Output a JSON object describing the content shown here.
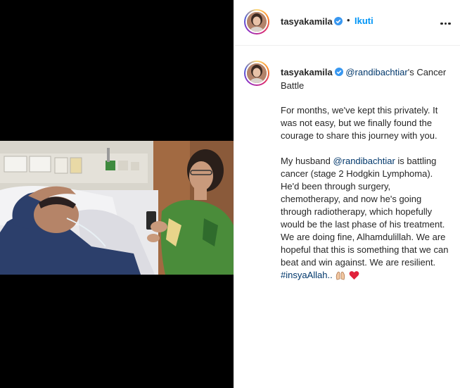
{
  "post": {
    "username": "tasyakamila",
    "follow_label": "Ikuti",
    "dot": "•"
  },
  "caption": {
    "username": "tasyakamila",
    "mention1": "@randibachtiar",
    "head_suffix": "'s Cancer Battle",
    "para1": "For months, we've kept this privately. It was not easy, but we finally found the courage to share this journey with you.",
    "para2_prefix": "My husband ",
    "mention2": "@randibachtiar",
    "para2_body": " is battling cancer (stage 2 Hodgkin Lymphoma). He'd been through surgery, chemotherapy, and now he's going through radiotherapy, which hopefully would be the last phase of his treatment. We are doing fine, Alhamdulillah. We are hopeful that this is something that we can beat and win against. We are resilient.",
    "hashtag": "#insyaAllah.."
  },
  "icons": [
    "verified-badge-icon",
    "more-options-icon",
    "praying-hands-emoji",
    "red-heart-emoji"
  ],
  "colors": {
    "accent": "#0095f6",
    "link": "#00376b",
    "text": "#262626",
    "verified": "#3897f0"
  }
}
